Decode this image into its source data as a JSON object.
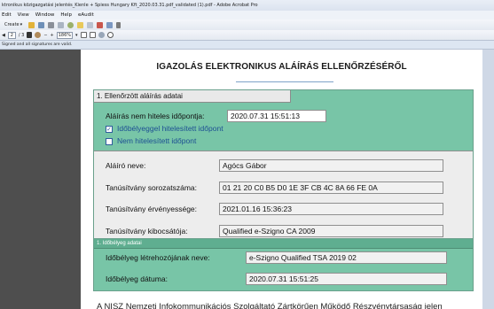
{
  "window": {
    "title": "ktronikus közigazgatási jelentés_Kienle + Spiess Hungary Kft_2020.03.31.pdf_validated (1).pdf - Adobe Acrobat Pro"
  },
  "menu": [
    "Edit",
    "View",
    "Window",
    "Help",
    "eAudit"
  ],
  "toolbar": {
    "create_label": "Create",
    "icons": [
      "folder-icon",
      "save-icon",
      "print-icon",
      "email-icon",
      "settings-icon",
      "comment-icon",
      "share-icon",
      "sign-icon",
      "stamp-icon",
      "pen-icon"
    ]
  },
  "nav": {
    "page_current": "2",
    "page_total": "/ 3",
    "zoom": "186%"
  },
  "signature_bar": {
    "message": "Signed and all signatures are valid."
  },
  "doc": {
    "title": "IGAZOLÁS ELEKTRONIKUS ALÁÍRÁS ELLENŐRZÉSÉRŐL",
    "section1": {
      "heading": "1. Ellenőrzött aláírás adatai",
      "time_label": "Aláírás nem hiteles időpontja:",
      "time_value": "2020.07.31 15:51:13",
      "checkbox1_label": "Időbélyeggel hitelesített időpont",
      "checkbox1_checked": true,
      "checkbox2_label": "Nem hitelesített időpont",
      "checkbox2_checked": false,
      "signer_label": "Aláíró neve:",
      "signer_value": "Agócs Gábor",
      "serial_label": "Tanúsítvány sorozatszáma:",
      "serial_value": "01 21 20 C0 B5 D0 1E 3F CB 4C 8A 66 FE 0A",
      "validity_label": "Tanúsítvány érvényessége:",
      "validity_value": "2021.01.16 15:36:23",
      "issuer_label": "Tanúsítvány kibocsátója:",
      "issuer_value": "Qualified e-Szigno CA 2009"
    },
    "section2": {
      "heading": "1. Időbélyeg adatai",
      "creator_label": "Időbélyeg létrehozójának neve:",
      "creator_value": "e-Szigno Qualified TSA 2019 02",
      "date_label": "Időbélyeg dátuma:",
      "date_value": "2020.07.31 15:51:25"
    },
    "paragraph": "A NISZ Nemzeti Infokommunikációs Szolgáltató Zártkörűen Működő Részvénytársaság jelen"
  }
}
